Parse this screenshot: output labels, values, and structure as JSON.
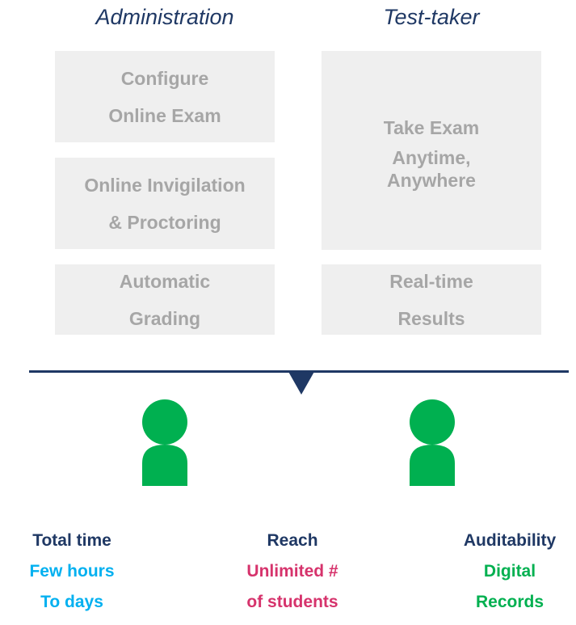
{
  "columns": {
    "administration": "Administration",
    "test_taker": "Test-taker"
  },
  "boxes": {
    "configure": [
      "Configure",
      "Online Exam"
    ],
    "invigilation": [
      "Online Invigilation",
      "& Proctoring"
    ],
    "grading": [
      "Automatic",
      "Grading"
    ],
    "take_exam": [
      "Take Exam",
      "Anytime,",
      "Anywhere"
    ],
    "results": [
      "Real-time",
      "Results"
    ]
  },
  "stats": {
    "time": {
      "label": "Total time",
      "value": [
        "Few hours",
        "To days"
      ]
    },
    "reach": {
      "label": "Reach",
      "value": [
        "Unlimited #",
        "of students"
      ]
    },
    "audit": {
      "label": "Auditability",
      "value": [
        "Digital",
        "Records"
      ]
    }
  },
  "colors": {
    "navy": "#1f3864",
    "box_bg": "#efefef",
    "box_text": "#a6a6a6",
    "person": "#00b050",
    "time_value": "#00b0f0",
    "reach_value": "#d6336c",
    "audit_value": "#00b050"
  },
  "icons": [
    "person-icon",
    "person-icon"
  ]
}
